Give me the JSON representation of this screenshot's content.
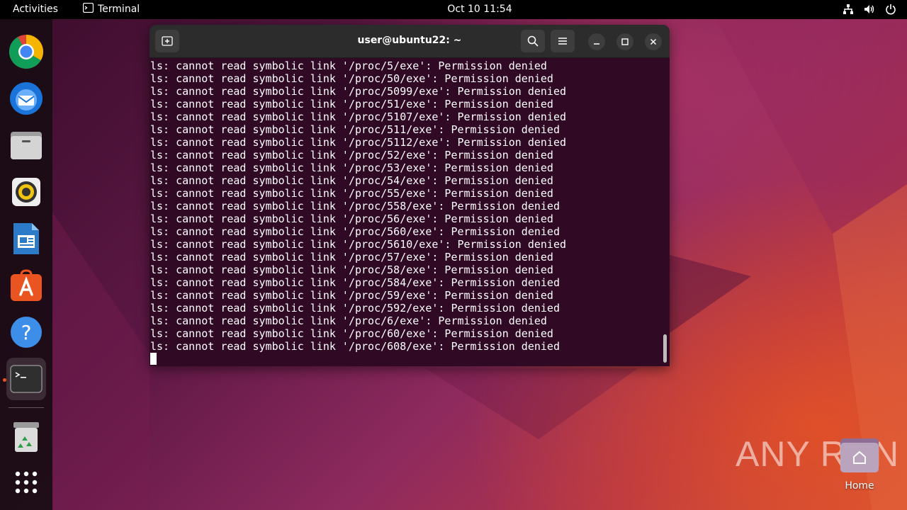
{
  "topbar": {
    "activities": "Activities",
    "app_name": "Terminal",
    "clock": "Oct 10  11:54",
    "tray_icons": [
      "network-icon",
      "volume-icon",
      "power-icon"
    ]
  },
  "dock": {
    "items": [
      {
        "name": "chrome",
        "icon": "chrome-icon"
      },
      {
        "name": "thunderbird",
        "icon": "thunderbird-icon"
      },
      {
        "name": "files",
        "icon": "files-icon"
      },
      {
        "name": "rhythmbox",
        "icon": "rhythmbox-icon"
      },
      {
        "name": "libreoffice-writer",
        "icon": "writer-icon"
      },
      {
        "name": "app-center",
        "icon": "app-center-icon"
      },
      {
        "name": "help",
        "icon": "help-icon"
      },
      {
        "name": "terminal",
        "icon": "terminal-icon",
        "active": true
      },
      {
        "name": "trash",
        "icon": "trash-icon"
      },
      {
        "name": "show-apps",
        "icon": "show-apps-icon"
      }
    ]
  },
  "terminal": {
    "title": "user@ubuntu22: ~",
    "lines": [
      "ls: cannot read symbolic link '/proc/5/exe': Permission denied",
      "ls: cannot read symbolic link '/proc/50/exe': Permission denied",
      "ls: cannot read symbolic link '/proc/5099/exe': Permission denied",
      "ls: cannot read symbolic link '/proc/51/exe': Permission denied",
      "ls: cannot read symbolic link '/proc/5107/exe': Permission denied",
      "ls: cannot read symbolic link '/proc/511/exe': Permission denied",
      "ls: cannot read symbolic link '/proc/5112/exe': Permission denied",
      "ls: cannot read symbolic link '/proc/52/exe': Permission denied",
      "ls: cannot read symbolic link '/proc/53/exe': Permission denied",
      "ls: cannot read symbolic link '/proc/54/exe': Permission denied",
      "ls: cannot read symbolic link '/proc/55/exe': Permission denied",
      "ls: cannot read symbolic link '/proc/558/exe': Permission denied",
      "ls: cannot read symbolic link '/proc/56/exe': Permission denied",
      "ls: cannot read symbolic link '/proc/560/exe': Permission denied",
      "ls: cannot read symbolic link '/proc/5610/exe': Permission denied",
      "ls: cannot read symbolic link '/proc/57/exe': Permission denied",
      "ls: cannot read symbolic link '/proc/58/exe': Permission denied",
      "ls: cannot read symbolic link '/proc/584/exe': Permission denied",
      "ls: cannot read symbolic link '/proc/59/exe': Permission denied",
      "ls: cannot read symbolic link '/proc/592/exe': Permission denied",
      "ls: cannot read symbolic link '/proc/6/exe': Permission denied",
      "ls: cannot read symbolic link '/proc/60/exe': Permission denied",
      "ls: cannot read symbolic link '/proc/608/exe': Permission denied"
    ]
  },
  "desktop": {
    "watermark": "ANY RUN",
    "home_label": "Home"
  },
  "colors": {
    "terminal_bg": "#300a24",
    "accent": "#e95420"
  }
}
